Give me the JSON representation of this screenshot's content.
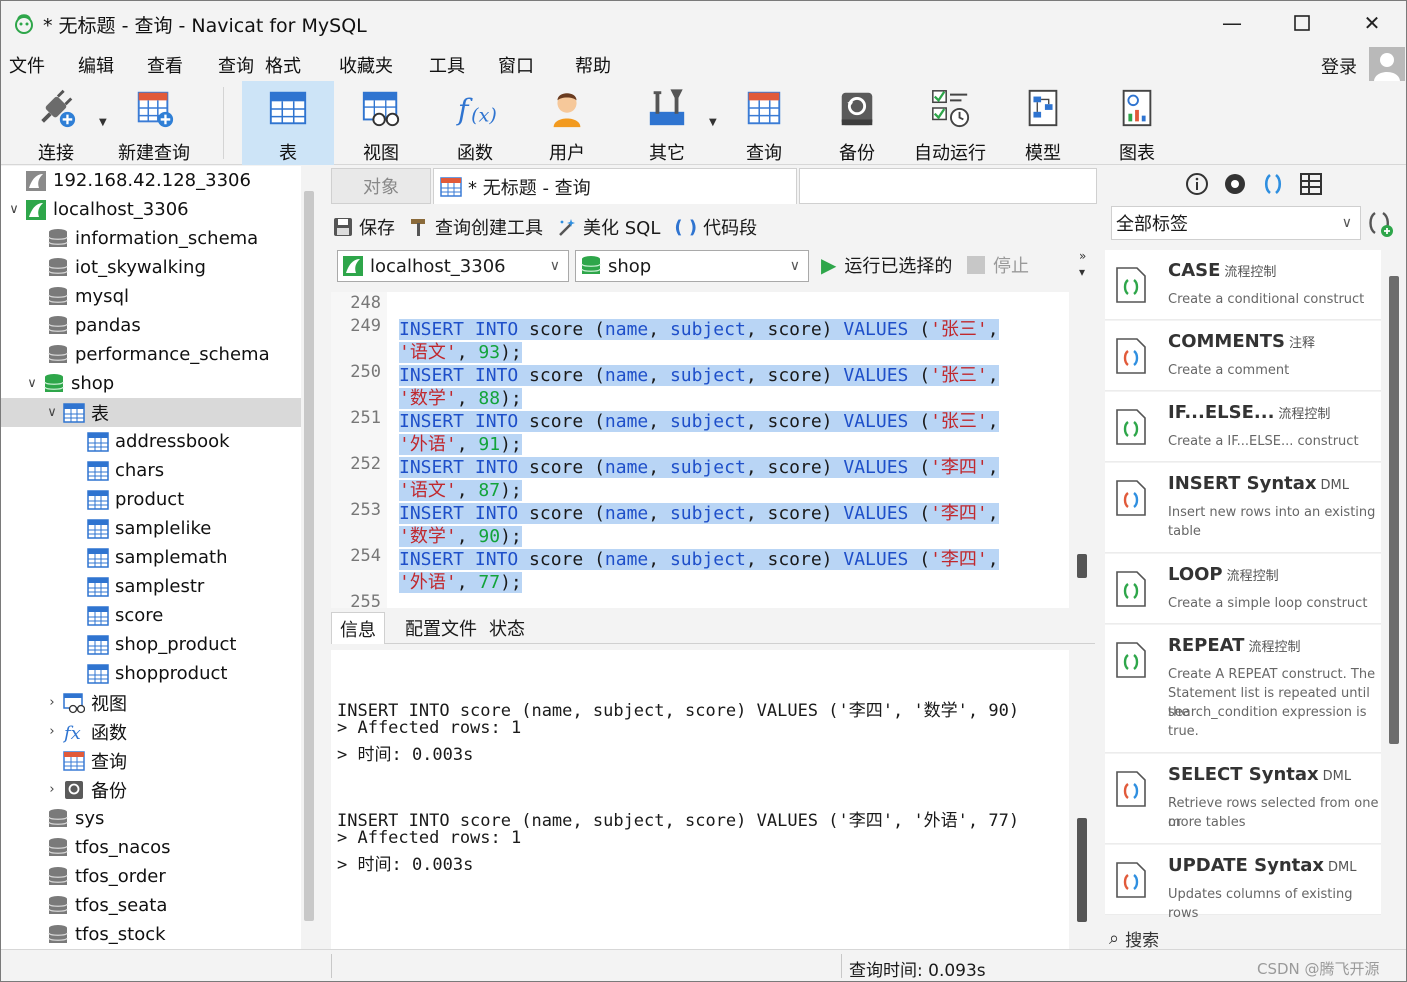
{
  "window": {
    "title": "* 无标题 - 查询 - Navicat for MySQL"
  },
  "menubar": {
    "items": [
      "文件",
      "编辑",
      "查看",
      "查询",
      "格式",
      "收藏夹",
      "工具",
      "窗口",
      "帮助"
    ],
    "login": "登录"
  },
  "toolbar": {
    "items": [
      {
        "label": "连接",
        "icon": "plug-icon"
      },
      {
        "label": "新建查询",
        "icon": "new-query-icon"
      },
      {
        "label": "表",
        "icon": "table-icon",
        "active": true
      },
      {
        "label": "视图",
        "icon": "view-icon"
      },
      {
        "label": "函数",
        "icon": "function-icon"
      },
      {
        "label": "用户",
        "icon": "user-icon"
      },
      {
        "label": "其它",
        "icon": "tools-icon"
      },
      {
        "label": "查询",
        "icon": "query-icon"
      },
      {
        "label": "备份",
        "icon": "backup-icon"
      },
      {
        "label": "自动运行",
        "icon": "schedule-icon"
      },
      {
        "label": "模型",
        "icon": "model-icon"
      },
      {
        "label": "图表",
        "icon": "chart-icon"
      }
    ]
  },
  "tree": {
    "nodes": [
      {
        "label": "192.168.42.128_3306",
        "type": "connection",
        "icon": "mysql-icon"
      },
      {
        "label": "localhost_3306",
        "type": "connection-open",
        "icon": "mysql-icon"
      },
      {
        "label": "information_schema",
        "type": "db"
      },
      {
        "label": "iot_skywalking",
        "type": "db"
      },
      {
        "label": "mysql",
        "type": "db"
      },
      {
        "label": "pandas",
        "type": "db"
      },
      {
        "label": "performance_schema",
        "type": "db"
      },
      {
        "label": "shop",
        "type": "db-open"
      },
      {
        "label": "表",
        "type": "folder-tables"
      },
      {
        "label": "addressbook",
        "type": "table"
      },
      {
        "label": "chars",
        "type": "table"
      },
      {
        "label": "product",
        "type": "table"
      },
      {
        "label": "samplelike",
        "type": "table"
      },
      {
        "label": "samplemath",
        "type": "table"
      },
      {
        "label": "samplestr",
        "type": "table"
      },
      {
        "label": "score",
        "type": "table"
      },
      {
        "label": "shop_product",
        "type": "table"
      },
      {
        "label": "shopproduct",
        "type": "table"
      },
      {
        "label": "视图",
        "type": "folder-views"
      },
      {
        "label": "函数",
        "type": "folder-functions"
      },
      {
        "label": "查询",
        "type": "folder-queries"
      },
      {
        "label": "备份",
        "type": "folder-backups"
      },
      {
        "label": "sys",
        "type": "db"
      },
      {
        "label": "tfos_nacos",
        "type": "db"
      },
      {
        "label": "tfos_order",
        "type": "db"
      },
      {
        "label": "tfos_seata",
        "type": "db"
      },
      {
        "label": "tfos_stock",
        "type": "db"
      }
    ]
  },
  "tabs": {
    "objects": "对象",
    "query": "* 无标题 - 查询"
  },
  "query_toolbar": {
    "save": "保存",
    "builder": "查询创建工具",
    "beautify": "美化 SQL",
    "snippet": "代码段",
    "connection": "localhost_3306",
    "database": "shop",
    "run_selected": "运行已选择的",
    "stop": "停止"
  },
  "editor": {
    "rows": [
      {
        "num": "248",
        "parts": []
      },
      {
        "num": "249",
        "parts": [
          [
            "kw",
            "INSERT INTO "
          ],
          [
            "id",
            "score ("
          ],
          [
            "kw",
            "name"
          ],
          [
            "id",
            ", "
          ],
          [
            "kw",
            "subject"
          ],
          [
            "id",
            ", score) "
          ],
          [
            "kw",
            "VALUES"
          ],
          [
            "id",
            " ("
          ],
          [
            "str",
            "'张三'"
          ],
          [
            "id",
            ","
          ]
        ]
      },
      {
        "num": "",
        "parts": [
          [
            "str",
            "'语文'"
          ],
          [
            "id",
            ", "
          ],
          [
            "num",
            "93"
          ],
          [
            "id",
            ");"
          ]
        ]
      },
      {
        "num": "250",
        "parts": [
          [
            "kw",
            "INSERT INTO "
          ],
          [
            "id",
            "score ("
          ],
          [
            "kw",
            "name"
          ],
          [
            "id",
            ", "
          ],
          [
            "kw",
            "subject"
          ],
          [
            "id",
            ", score) "
          ],
          [
            "kw",
            "VALUES"
          ],
          [
            "id",
            " ("
          ],
          [
            "str",
            "'张三'"
          ],
          [
            "id",
            ","
          ]
        ]
      },
      {
        "num": "",
        "parts": [
          [
            "str",
            "'数学'"
          ],
          [
            "id",
            ", "
          ],
          [
            "num",
            "88"
          ],
          [
            "id",
            ");"
          ]
        ]
      },
      {
        "num": "251",
        "parts": [
          [
            "kw",
            "INSERT INTO "
          ],
          [
            "id",
            "score ("
          ],
          [
            "kw",
            "name"
          ],
          [
            "id",
            ", "
          ],
          [
            "kw",
            "subject"
          ],
          [
            "id",
            ", score) "
          ],
          [
            "kw",
            "VALUES"
          ],
          [
            "id",
            " ("
          ],
          [
            "str",
            "'张三'"
          ],
          [
            "id",
            ","
          ]
        ]
      },
      {
        "num": "",
        "parts": [
          [
            "str",
            "'外语'"
          ],
          [
            "id",
            ", "
          ],
          [
            "num",
            "91"
          ],
          [
            "id",
            ");"
          ]
        ]
      },
      {
        "num": "252",
        "parts": [
          [
            "kw",
            "INSERT INTO "
          ],
          [
            "id",
            "score ("
          ],
          [
            "kw",
            "name"
          ],
          [
            "id",
            ", "
          ],
          [
            "kw",
            "subject"
          ],
          [
            "id",
            ", score) "
          ],
          [
            "kw",
            "VALUES"
          ],
          [
            "id",
            " ("
          ],
          [
            "str",
            "'李四'"
          ],
          [
            "id",
            ","
          ]
        ]
      },
      {
        "num": "",
        "parts": [
          [
            "str",
            "'语文'"
          ],
          [
            "id",
            ", "
          ],
          [
            "num",
            "87"
          ],
          [
            "id",
            ");"
          ]
        ]
      },
      {
        "num": "253",
        "parts": [
          [
            "kw",
            "INSERT INTO "
          ],
          [
            "id",
            "score ("
          ],
          [
            "kw",
            "name"
          ],
          [
            "id",
            ", "
          ],
          [
            "kw",
            "subject"
          ],
          [
            "id",
            ", score) "
          ],
          [
            "kw",
            "VALUES"
          ],
          [
            "id",
            " ("
          ],
          [
            "str",
            "'李四'"
          ],
          [
            "id",
            ","
          ]
        ]
      },
      {
        "num": "",
        "parts": [
          [
            "str",
            "'数学'"
          ],
          [
            "id",
            ", "
          ],
          [
            "num",
            "90"
          ],
          [
            "id",
            ");"
          ]
        ]
      },
      {
        "num": "254",
        "parts": [
          [
            "kw",
            "INSERT INTO "
          ],
          [
            "id",
            "score ("
          ],
          [
            "kw",
            "name"
          ],
          [
            "id",
            ", "
          ],
          [
            "kw",
            "subject"
          ],
          [
            "id",
            ", score) "
          ],
          [
            "kw",
            "VALUES"
          ],
          [
            "id",
            " ("
          ],
          [
            "str",
            "'李四'"
          ],
          [
            "id",
            ","
          ]
        ]
      },
      {
        "num": "",
        "parts": [
          [
            "str",
            "'外语'"
          ],
          [
            "id",
            ", "
          ],
          [
            "num",
            "77"
          ],
          [
            "id",
            ");"
          ]
        ]
      },
      {
        "num": "255",
        "parts": []
      }
    ]
  },
  "result_tabs": [
    "信息",
    "配置文件",
    "状态"
  ],
  "messages": [
    "INSERT INTO score (name, subject, score) VALUES ('李四', '数学', 90)",
    "> Affected rows: 1",
    "> 时间: 0.003s",
    "",
    "",
    "INSERT INTO score (name, subject, score) VALUES ('李四', '外语', 77)",
    "> Affected rows: 1",
    "> 时间: 0.003s"
  ],
  "snippets_panel": {
    "filter": "全部标签",
    "search_placeholder": "搜索",
    "items": [
      {
        "title": "CASE",
        "tag": "流程控制",
        "desc": [
          "Create a conditional construct"
        ]
      },
      {
        "title": "COMMENTS",
        "tag": "注释",
        "desc": [
          "Create a comment"
        ]
      },
      {
        "title": "IF...ELSE...",
        "tag": "流程控制",
        "desc": [
          "Create a IF...ELSE... construct"
        ]
      },
      {
        "title": "INSERT Syntax",
        "tag": "DML",
        "desc": [
          "Insert new rows into an existing",
          "table"
        ]
      },
      {
        "title": "LOOP",
        "tag": "流程控制",
        "desc": [
          "Create a simple loop construct"
        ]
      },
      {
        "title": "REPEAT",
        "tag": "流程控制",
        "desc": [
          "Create A REPEAT construct. The",
          "Statement list is repeated until the",
          "search_condition expression is",
          "true."
        ]
      },
      {
        "title": "SELECT Syntax",
        "tag": "DML",
        "desc": [
          "Retrieve rows selected from one or",
          "more tables"
        ]
      },
      {
        "title": "UPDATE Syntax",
        "tag": "DML",
        "desc": [
          "Updates columns of existing rows"
        ]
      }
    ]
  },
  "statusbar": {
    "query_time": "查询时间: 0.093s",
    "watermark": "CSDN @腾飞开源"
  },
  "colors": {
    "keyword": "#1e4fc9",
    "string": "#c0282d",
    "number": "#12a33a",
    "selection": "#b9d5f5",
    "active_tool": "#cde4f7"
  }
}
